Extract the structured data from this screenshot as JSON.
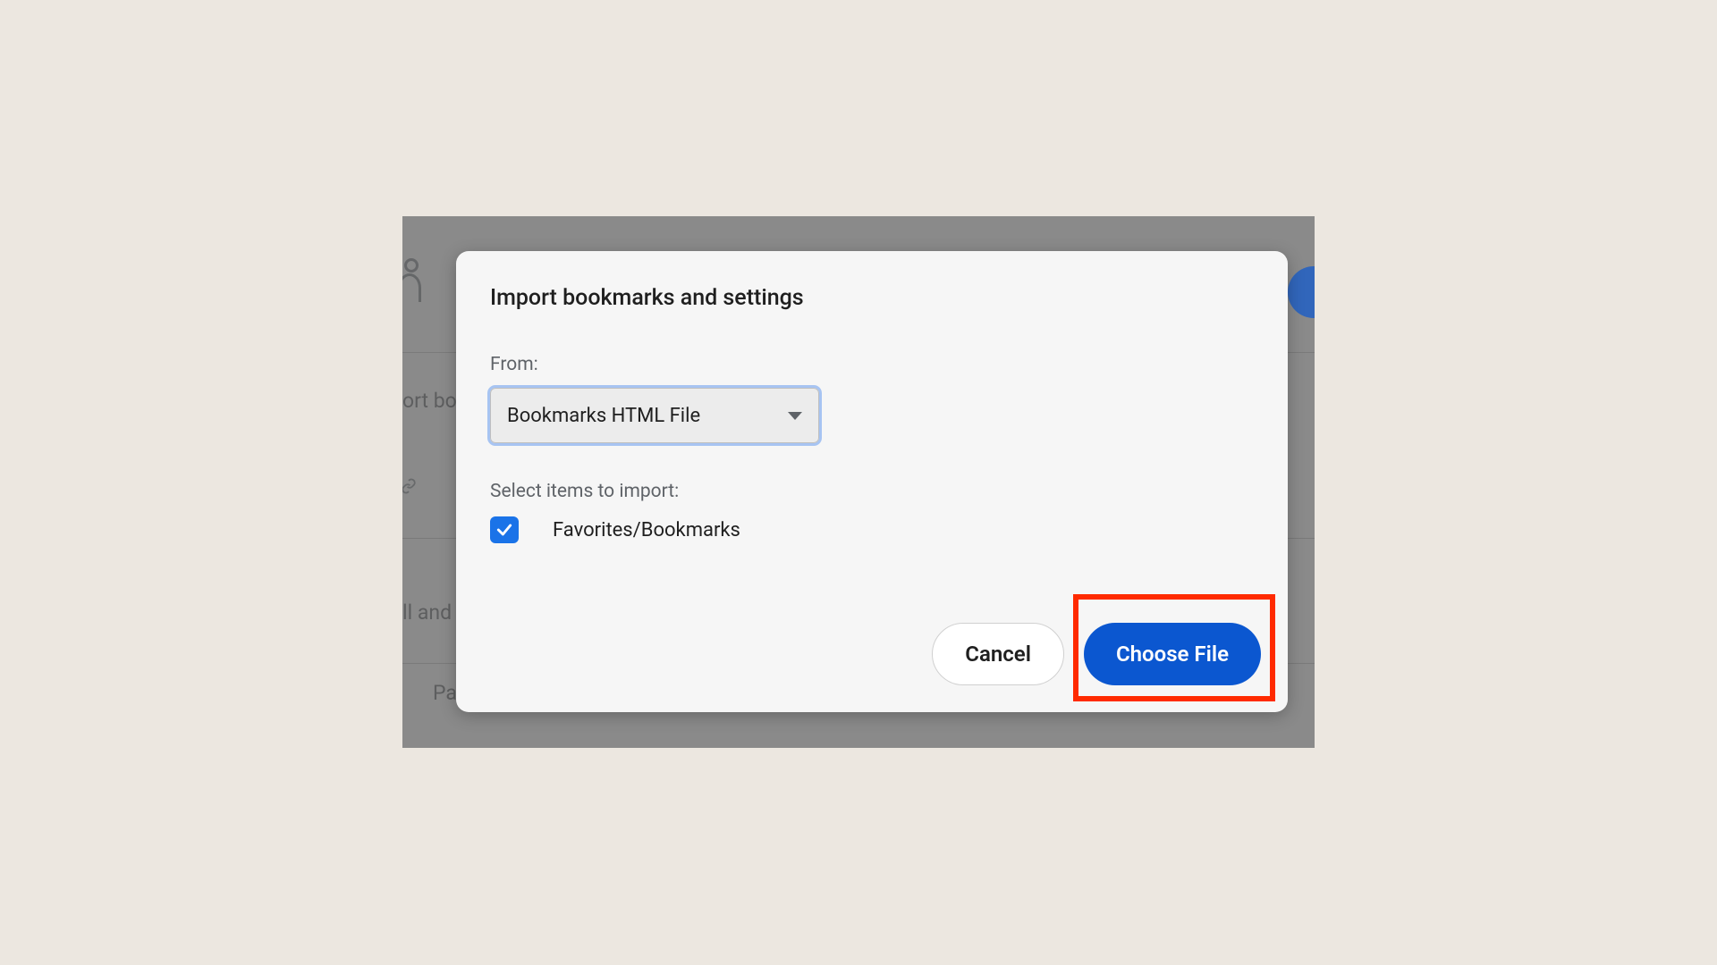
{
  "dialog": {
    "title": "Import bookmarks and settings",
    "from_label": "From:",
    "from_selected": "Bookmarks HTML File",
    "select_items_label": "Select items to import:",
    "checkbox": {
      "checked": true,
      "label": "Favorites/Bookmarks"
    },
    "cancel_label": "Cancel",
    "primary_label": "Choose File"
  },
  "background": {
    "text_1": "ort bo",
    "text_2": "ll and",
    "text_3": "Pa"
  },
  "colors": {
    "accent": "#0b57d0",
    "checkbox": "#1a73e8",
    "highlight": "#ff2a00"
  }
}
